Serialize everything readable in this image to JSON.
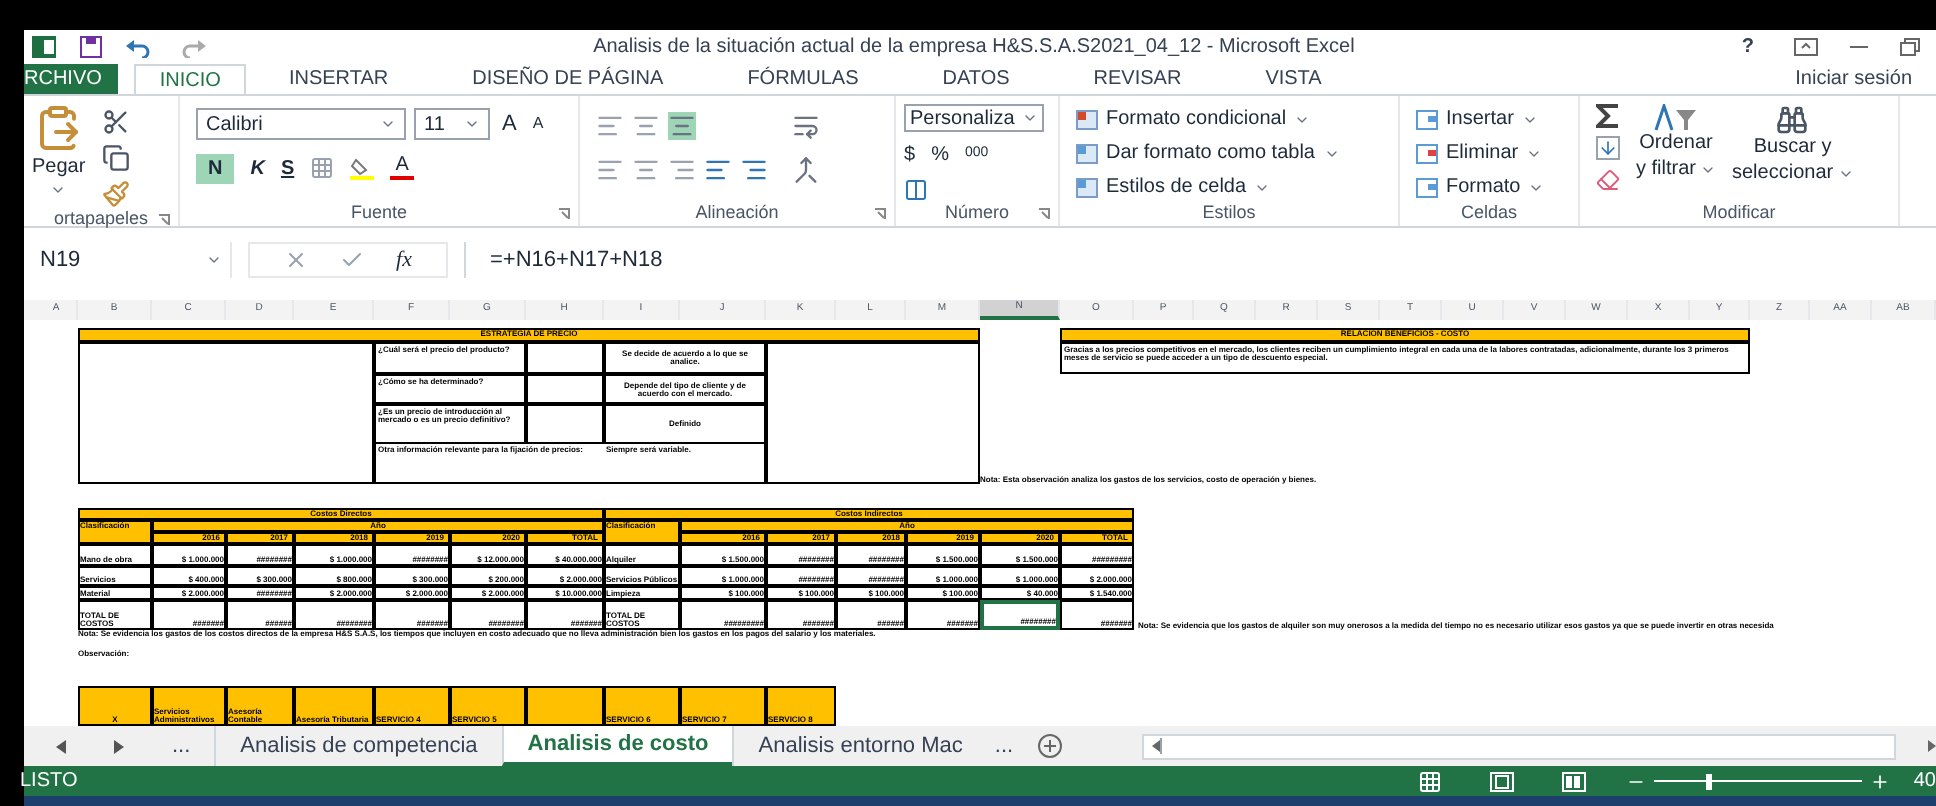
{
  "window": {
    "title": "Analisis de la situación actual de la empresa H&S.S.A.S2021_04_12 - Microsoft Excel",
    "help": "?"
  },
  "menu_tabs": [
    {
      "label": "RCHIVO",
      "kind": "file",
      "selected": false
    },
    {
      "label": "INICIO",
      "kind": "tab",
      "selected": true
    },
    {
      "label": "INSERTAR",
      "kind": "tab",
      "selected": false
    },
    {
      "label": "DISEÑO DE PÁGINA",
      "kind": "tab",
      "selected": false
    },
    {
      "label": "FÓRMULAS",
      "kind": "tab",
      "selected": false
    },
    {
      "label": "DATOS",
      "kind": "tab",
      "selected": false
    },
    {
      "label": "REVISAR",
      "kind": "tab",
      "selected": false
    },
    {
      "label": "VISTA",
      "kind": "tab",
      "selected": false
    }
  ],
  "sign_in": "Iniciar sesión",
  "ribbon": {
    "clipboard": {
      "paste": "Pegar",
      "label": "ortapapeles"
    },
    "font": {
      "name": "Calibri",
      "size": "11",
      "grow": "A",
      "shrink": "A",
      "bold": "N",
      "italic": "K",
      "underline": "S",
      "font_color_button": "A",
      "label": "Fuente"
    },
    "alignment": {
      "label": "Alineación"
    },
    "number": {
      "format": "Personaliza",
      "currency": "$",
      "percent": "%",
      "thousands": "000",
      "label": "Número"
    },
    "styles": {
      "items": [
        "Formato condicional",
        "Dar formato como tabla",
        "Estilos de celda"
      ],
      "label": "Estilos"
    },
    "cells": {
      "items": [
        "Insertar",
        "Eliminar",
        "Formato"
      ],
      "label": "Celdas"
    },
    "editing": {
      "sort": [
        "Ordenar",
        "y filtrar"
      ],
      "find": [
        "Buscar y",
        "seleccionar"
      ],
      "label": "Modificar"
    }
  },
  "formula_bar": {
    "name_box": "N19",
    "fx": "fx",
    "formula": "=+N16+N17+N18"
  },
  "column_headers": [
    {
      "label": "A",
      "selected": false
    },
    {
      "label": "B",
      "selected": false
    },
    {
      "label": "C",
      "selected": false
    },
    {
      "label": "D",
      "selected": false
    },
    {
      "label": "E",
      "selected": false
    },
    {
      "label": "F",
      "selected": false
    },
    {
      "label": "G",
      "selected": false
    },
    {
      "label": "H",
      "selected": false
    },
    {
      "label": "I",
      "selected": false
    },
    {
      "label": "J",
      "selected": false
    },
    {
      "label": "K",
      "selected": false
    },
    {
      "label": "L",
      "selected": false
    },
    {
      "label": "M",
      "selected": false
    },
    {
      "label": "N",
      "selected": true
    },
    {
      "label": "O",
      "selected": false
    },
    {
      "label": "P",
      "selected": false
    },
    {
      "label": "Q",
      "selected": false
    },
    {
      "label": "R",
      "selected": false
    },
    {
      "label": "S",
      "selected": false
    },
    {
      "label": "T",
      "selected": false
    },
    {
      "label": "U",
      "selected": false
    },
    {
      "label": "V",
      "selected": false
    },
    {
      "label": "W",
      "selected": false
    },
    {
      "label": "X",
      "selected": false
    },
    {
      "label": "Y",
      "selected": false
    },
    {
      "label": "Z",
      "selected": false
    },
    {
      "label": "AA",
      "selected": false
    },
    {
      "label": "AB",
      "selected": false
    }
  ],
  "price_strategy": {
    "title": "ESTRATÉGIA DE PRECIO",
    "questions": [
      {
        "question": "¿Cuál será el precio del producto?",
        "answer": "Se decide de acuerdo a lo que se analice."
      },
      {
        "question": "¿Cómo se ha determinado?",
        "answer": "Depende del tipo de cliente y de acuerdo con el mercado."
      },
      {
        "question": "¿Es un precio de introducción al mercado o es un precio definitivo?",
        "answer": "Definido"
      }
    ],
    "other_label": "Otra información relevante para la fijación de precios:",
    "other_value": "Siempre será variable."
  },
  "benefit_cost": {
    "title": "RELACIÓN BENEFICIOS - COSTO",
    "text": "Gracias a los precios competitivos en el mercado, los clientes reciben un cumplimiento integral en cada una de la labores contratadas, adicionalmente, durante los 3 primeros meses de servicio se puede acceder a un tipo de descuento especial.",
    "note": "Nota: Esta observación analiza los gastos de los servicios, costo de operación y bienes."
  },
  "direct_costs": {
    "title": "Costos Directos",
    "class_header": "Clasificación",
    "year_header": "Año",
    "columns": [
      "2016",
      "2017",
      "2018",
      "2019",
      "2020",
      "TOTAL"
    ],
    "rows": [
      {
        "label": "Mano de obra",
        "values": [
          {
            "v": "$ 1.000.000",
            "selected": false
          },
          {
            "v": "########",
            "selected": false
          },
          {
            "v": "$ 1.000.000",
            "selected": false
          },
          {
            "v": "########",
            "selected": false
          },
          {
            "v": "$ 12.000.000",
            "selected": false
          },
          {
            "v": "$ 40.000.000",
            "selected": false
          }
        ]
      },
      {
        "label": "Servicios",
        "values": [
          {
            "v": "$ 400.000",
            "selected": false
          },
          {
            "v": "$ 300.000",
            "selected": false
          },
          {
            "v": "$ 800.000",
            "selected": false
          },
          {
            "v": "$ 300.000",
            "selected": false
          },
          {
            "v": "$ 200.000",
            "selected": false
          },
          {
            "v": "$ 2.000.000",
            "selected": false
          }
        ]
      },
      {
        "label": "Material",
        "values": [
          {
            "v": "$ 2.000.000",
            "selected": false
          },
          {
            "v": "########",
            "selected": false
          },
          {
            "v": "$ 2.000.000",
            "selected": false
          },
          {
            "v": "$ 2.000.000",
            "selected": false
          },
          {
            "v": "$ 2.000.000",
            "selected": false
          },
          {
            "v": "$ 10.000.000",
            "selected": false
          }
        ]
      },
      {
        "label": "TOTAL DE COSTOS",
        "values": [
          {
            "v": "#######",
            "selected": false
          },
          {
            "v": "######",
            "selected": false
          },
          {
            "v": "########",
            "selected": false
          },
          {
            "v": "#######",
            "selected": false
          },
          {
            "v": "########",
            "selected": false
          },
          {
            "v": "#######",
            "selected": false
          }
        ]
      }
    ]
  },
  "indirect_costs": {
    "title": "Costos Indirectos",
    "class_header": "Clasificación",
    "year_header": "Año",
    "columns": [
      "2016",
      "2017",
      "2018",
      "2019",
      "2020",
      "TOTAL"
    ],
    "rows": [
      {
        "label": "Alquiler",
        "values": [
          {
            "v": "$ 1.500.000",
            "selected": false
          },
          {
            "v": "########",
            "selected": false
          },
          {
            "v": "########",
            "selected": false
          },
          {
            "v": "$ 1.500.000",
            "selected": false
          },
          {
            "v": "$ 1.500.000",
            "selected": false
          },
          {
            "v": "#########",
            "selected": false
          }
        ]
      },
      {
        "label": "Servicios Públicos",
        "values": [
          {
            "v": "$ 1.000.000",
            "selected": false
          },
          {
            "v": "########",
            "selected": false
          },
          {
            "v": "########",
            "selected": false
          },
          {
            "v": "$ 1.000.000",
            "selected": false
          },
          {
            "v": "$ 1.000.000",
            "selected": false
          },
          {
            "v": "$ 2.000.000",
            "selected": false
          }
        ]
      },
      {
        "label": "Limpieza",
        "values": [
          {
            "v": "$ 100.000",
            "selected": false
          },
          {
            "v": "$ 100.000",
            "selected": false
          },
          {
            "v": "$ 100.000",
            "selected": false
          },
          {
            "v": "$ 100.000",
            "selected": false
          },
          {
            "v": "$ 40.000",
            "selected": false
          },
          {
            "v": "$ 1.540.000",
            "selected": false
          }
        ]
      },
      {
        "label": "TOTAL DE COSTOS",
        "values": [
          {
            "v": "#########",
            "selected": false
          },
          {
            "v": "#######",
            "selected": false
          },
          {
            "v": "######",
            "selected": false
          },
          {
            "v": "#######",
            "selected": false
          },
          {
            "v": "########",
            "selected": true
          },
          {
            "v": "#######",
            "selected": false
          }
        ]
      }
    ]
  },
  "direct_note": "Nota: Se evidencia los gastos de los costos directos de la empresa H&S S.A.S, los tiempos que incluyen en costo adecuado que no lleva administración bien los gastos en los pagos del salario y los materiales.",
  "indirect_note": "Nota: Se evidencia que los gastos de alquiler son muy onerosos a la medida del tiempo no es necesario utilizar esos gastos ya que se puede invertir en otras necesida",
  "observation": "Observación:",
  "services": [
    "X",
    "Servicios Administrativos",
    "Asesoría Contable",
    "Asesoría Tributaria",
    "SERVICIO 4",
    "SERVICIO 5",
    "SERVICIO 6",
    "SERVICIO 7",
    "SERVICIO 8"
  ],
  "sheet_tabs": {
    "more_left": "...",
    "tabs": [
      {
        "label": "Analisis de competencia",
        "selected": false
      },
      {
        "label": "Analisis de costo",
        "selected": true
      },
      {
        "label": "Analisis entorno Mac",
        "selected": false
      }
    ],
    "more_right": "..."
  },
  "status_bar": {
    "status": "LISTO",
    "zoom": {
      "level": 0.25,
      "reading": "40"
    }
  }
}
